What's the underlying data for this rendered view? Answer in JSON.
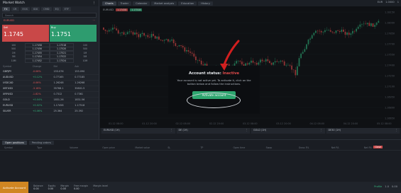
{
  "market_watch": {
    "title": "Market Watch",
    "filters": [
      "FX",
      "CR",
      "EGS",
      "IDX",
      "CMD",
      "EQ",
      "ETF"
    ],
    "search_placeholder": "Search",
    "columns": [
      "Symbol",
      "Change",
      "Bid",
      "Ask"
    ],
    "selected_symbol": "EURUSD",
    "card": {
      "sell_label": "Sell",
      "buy_label": "Buy",
      "sell_price": "1.1745",
      "buy_price": "1.1751"
    },
    "ladder": [
      [
        "100",
        "1.17458",
        "1.17518",
        "100"
      ],
      [
        "500",
        "1.17456",
        "1.17520",
        "500"
      ],
      [
        "1M",
        "1.17455",
        "1.17521",
        "1M"
      ],
      [
        "5M",
        "1.17454",
        "1.17522",
        "5M"
      ],
      [
        "10M",
        "1.17452",
        "1.17524",
        "10M"
      ]
    ],
    "rows": [
      [
        "GBPJPY",
        "-0.06%",
        "153.076",
        "153.090"
      ],
      [
        "AUDUSD",
        "+0.12%",
        "0.77165",
        "0.77185"
      ],
      [
        "USDCAD",
        "-0.06%",
        "1.26248",
        "1.26268"
      ],
      [
        "XBTUSD",
        "-3.18%",
        "35768.1",
        "35801.5"
      ],
      [
        "XRPUSD",
        "-1.82%",
        "0.7312",
        "0.7361"
      ],
      [
        "GOLD",
        "+0.04%",
        "1831.26",
        "1831.56"
      ],
      [
        "EURUSD",
        "+0.02%",
        "1.17458",
        "1.17518"
      ],
      [
        "SILVER",
        "+0.06%",
        "25.364",
        "25.392"
      ]
    ]
  },
  "topbar": {
    "tabs": [
      "Charts",
      "Trader",
      "Calendar",
      "Market analysis",
      "Education",
      "History"
    ],
    "right": [
      "EUR",
      "1.0000",
      "1"
    ]
  },
  "chart": {
    "symbol": "EURUSD",
    "sell": "1.17458",
    "buy": "1.17518",
    "price_axis": [
      "1.18150",
      "1.18000",
      "1.17850",
      "1.17700",
      "1.17550",
      "1.17400",
      "1.17250",
      "1.17100",
      "1.16950",
      "1.16800",
      "1.16650"
    ],
    "time_axis": [
      "01.12 08:00",
      "01.12 20:00",
      "02.12 08:00",
      "02.12 20:00",
      "03.12 08:00",
      "03.12 20:00",
      "04.12 08:00",
      "04.12 20:00",
      "05.12 08:00"
    ]
  },
  "chart_tabs": [
    "EURUSD (1H)",
    "DE (1H)",
    "GOLD (1H)",
    "DE30 (1H)"
  ],
  "modal": {
    "title": "Account status:",
    "status": "Inactive",
    "message": "Your account is not active yet. To activate it, click on the button below and follow the instructions.",
    "button": "Activate account"
  },
  "positions": {
    "tabs": [
      "Open positions",
      "Pending orders"
    ],
    "columns": [
      "Symbol",
      "Type",
      "Volume",
      "Open price",
      "Market value",
      "SL",
      "TP",
      "Open time",
      "Swap",
      "Gross P/L",
      "Net P/L",
      "Net P/L %"
    ],
    "close_label": "Close"
  },
  "statusbar": {
    "activate": "Activate Account",
    "metrics": [
      [
        "Balance",
        "0.00"
      ],
      [
        "Equity",
        "0.00"
      ],
      [
        "Margin",
        "0.00"
      ],
      [
        "Free margin",
        "0.00"
      ],
      [
        "Margin level",
        "-"
      ]
    ],
    "right": [
      "Profile",
      "1.0",
      "0.00"
    ]
  },
  "colors": {
    "sell": "#c94848",
    "buy": "#2e9c6f",
    "accent": "#d08622",
    "arrow": "#d11f1f"
  }
}
